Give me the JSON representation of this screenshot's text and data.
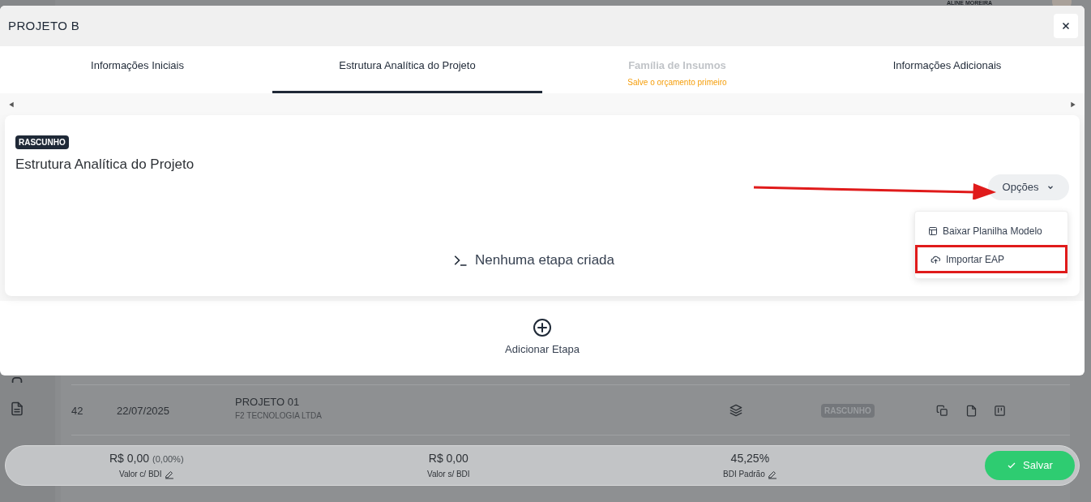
{
  "background": {
    "user_name": "ALINE MOREIRA",
    "row": {
      "id": "42",
      "date": "22/07/2025",
      "title": "PROJETO 01",
      "company": "F2 TECNOLOGIA LTDA",
      "status": "RASCUNHO"
    }
  },
  "modal": {
    "title": "PROJETO B",
    "tabs": [
      {
        "label": "Informações Iniciais",
        "selected": false,
        "disabled": false
      },
      {
        "label": "Estrutura Analítica do Projeto",
        "selected": true,
        "disabled": false
      },
      {
        "label": "Família de Insumos",
        "hint": "Salve o orçamento primeiro",
        "selected": false,
        "disabled": true
      },
      {
        "label": "Informações Adicionais",
        "selected": false,
        "disabled": false
      }
    ],
    "status_badge": "RASCUNHO",
    "heading": "Estrutura Analítica do Projeto",
    "options_button": "Opções",
    "options_menu": [
      {
        "label": "Baixar Planilha Modelo",
        "kind": "table",
        "highlighted": false
      },
      {
        "label": "Importar EAP",
        "kind": "upload",
        "highlighted": true
      }
    ],
    "empty_state": "Nenhuma etapa criada",
    "add_button": "Adicionar Etapa"
  },
  "footer": {
    "items": [
      {
        "value": "R$ 0,00",
        "note": "(0,00%)",
        "label": "Valor c/ BDI",
        "editable": true
      },
      {
        "value": "R$ 0,00",
        "label": "Valor s/ BDI",
        "editable": false
      },
      {
        "value": "45,25%",
        "label": "BDI Padrão",
        "editable": true
      }
    ],
    "save_button": "Salvar"
  }
}
